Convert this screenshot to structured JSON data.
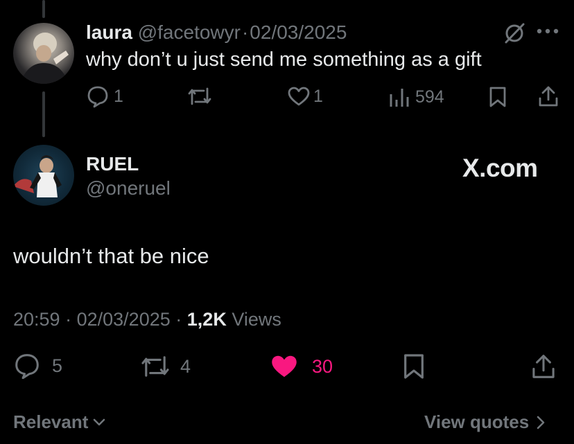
{
  "reply": {
    "name": "laura",
    "handle": "@facetowyr",
    "separator": "·",
    "date": "02/03/2025",
    "text": "why don’t u just send me something as a gift",
    "replies": "1",
    "likes": "1",
    "views": "594"
  },
  "main": {
    "name": "RUEL",
    "handle": "@oneruel",
    "text": "wouldn’t that be nice",
    "time": "20:59",
    "separator": "·",
    "date": "02/03/2025",
    "views_count": "1,2K",
    "views_label": "Views",
    "replies": "5",
    "reposts": "4",
    "likes": "30"
  },
  "watermark": "X.com",
  "footer": {
    "sort_label": "Relevant",
    "quotes_label": "View quotes"
  },
  "colors": {
    "background": "#000000",
    "text": "#e7e9ea",
    "muted": "#71767b",
    "like_active": "#f91880",
    "thread_line": "#333639"
  }
}
